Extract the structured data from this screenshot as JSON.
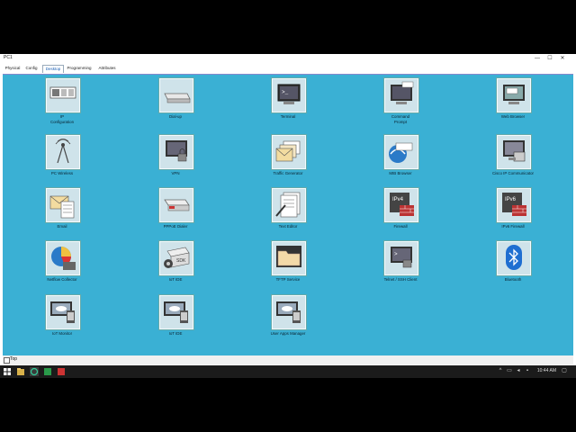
{
  "window": {
    "title": "PC1",
    "controls": {
      "minimize": "—",
      "maximize": "☐",
      "close": "✕"
    }
  },
  "tabs": [
    {
      "label": "Physical",
      "active": false
    },
    {
      "label": "Config",
      "active": false
    },
    {
      "label": "Desktop",
      "active": true
    },
    {
      "label": "Programming",
      "active": false
    },
    {
      "label": "Attributes",
      "active": false
    }
  ],
  "apps": [
    {
      "label": "IP\nConfiguration",
      "icon": "ip-configuration-icon"
    },
    {
      "label": "Dial-up",
      "icon": "dialup-modem-icon"
    },
    {
      "label": "Terminal",
      "icon": "terminal-icon"
    },
    {
      "label": "Command\nPrompt",
      "icon": "command-prompt-icon"
    },
    {
      "label": "Web Browser",
      "icon": "web-browser-icon"
    },
    {
      "label": "PC Wireless",
      "icon": "wireless-icon"
    },
    {
      "label": "VPN",
      "icon": "vpn-icon"
    },
    {
      "label": "Traffic Generator",
      "icon": "traffic-generator-icon"
    },
    {
      "label": "MIB Browser",
      "icon": "mib-browser-icon"
    },
    {
      "label": "Cisco IP Communicator",
      "icon": "ip-communicator-icon"
    },
    {
      "label": "Email",
      "icon": "email-icon"
    },
    {
      "label": "PPPoE Dialer",
      "icon": "pppoe-dialer-icon"
    },
    {
      "label": "Text Editor",
      "icon": "text-editor-icon"
    },
    {
      "label": "Firewall",
      "icon": "ipv4-firewall-icon",
      "badge": "IPv4"
    },
    {
      "label": "IPv6 Firewall",
      "icon": "ipv6-firewall-icon",
      "badge": "IPv6"
    },
    {
      "label": "Netflow Collector",
      "icon": "netflow-collector-icon"
    },
    {
      "label": "IoT IDE",
      "icon": "iot-ide-icon",
      "badge": "SDK"
    },
    {
      "label": "TFTP Service",
      "icon": "tftp-service-icon"
    },
    {
      "label": "Telnet / SSH Client",
      "icon": "telnet-ssh-icon"
    },
    {
      "label": "Bluetooth",
      "icon": "bluetooth-icon"
    },
    {
      "label": "IoT Monitor",
      "icon": "iot-monitor-icon"
    },
    {
      "label": "IoT IDE",
      "icon": "iot-ide-cloud-icon"
    },
    {
      "label": "User Apps Manager",
      "icon": "user-apps-manager-icon"
    }
  ],
  "statusbar": {
    "top_label": "Top"
  },
  "taskbar": {
    "time": "10:44 AM"
  },
  "colors": {
    "desktop": "#3ab0d4",
    "accent": "#1a5fb4"
  }
}
